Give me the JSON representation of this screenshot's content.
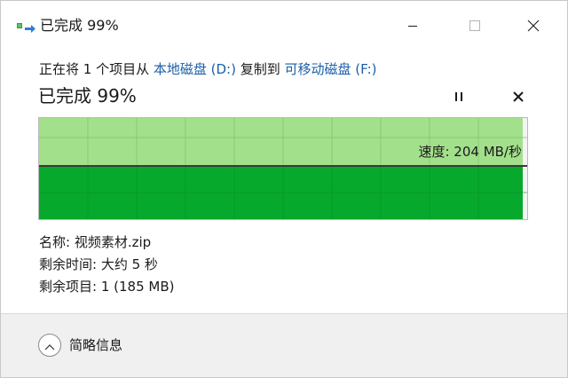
{
  "window": {
    "title": "已完成 99%",
    "icon": "file-copy-icon",
    "controls": {
      "minimize": "minimize-icon",
      "maximize": "maximize-icon",
      "close": "close-icon"
    }
  },
  "copy": {
    "prefix": "正在将 1 个项目从 ",
    "source": "本地磁盘 (D:)",
    "middle": " 复制到 ",
    "destination": "可移动磁盘 (F:)"
  },
  "progress": {
    "title": "已完成 99%",
    "percent": 99,
    "speed_label": "速度: 204 MB/秒",
    "pause_icon": "pause-icon",
    "cancel_icon": "cancel-icon"
  },
  "details": {
    "name": "名称: 视频素材.zip",
    "time_remaining": "剩余时间: 大约 5 秒",
    "items_remaining": "剩余项目: 1 (185 MB)"
  },
  "footer": {
    "toggle_icon": "chevron-up-icon",
    "label": "简略信息"
  },
  "colors": {
    "graph_light": "#a3e08c",
    "graph_dark": "#06a92c",
    "link": "#1a5fa8",
    "footer_bg": "#f0f0f0"
  }
}
